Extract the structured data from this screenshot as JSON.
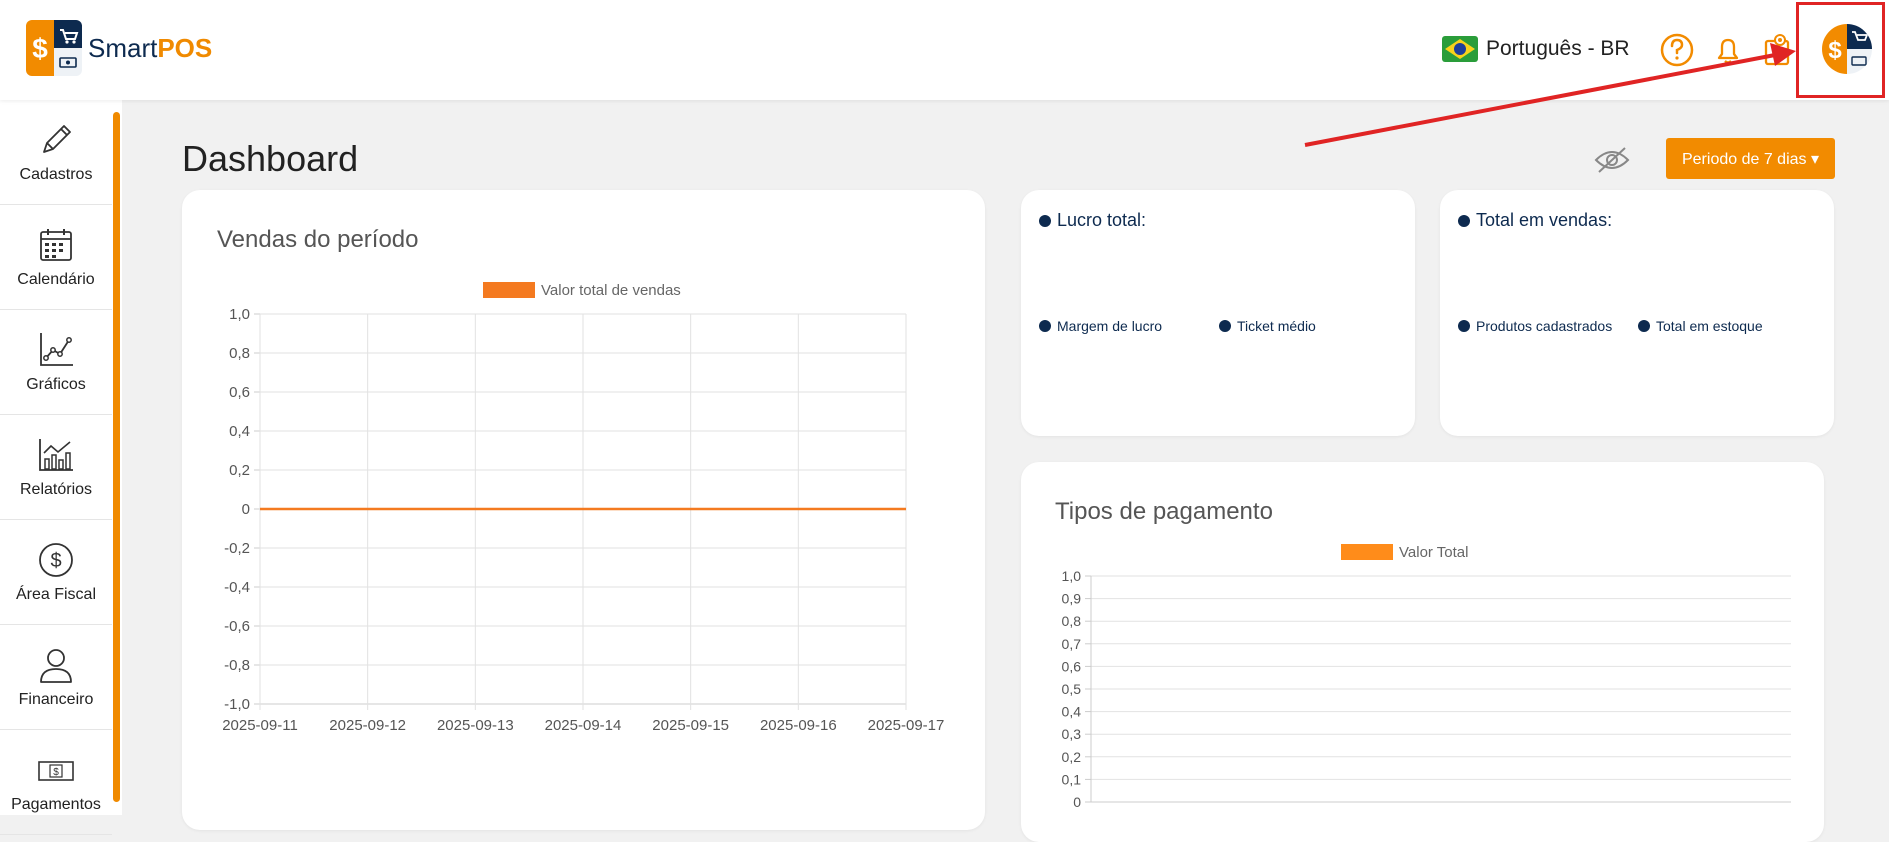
{
  "header": {
    "brand_part1": "Smart",
    "brand_part2": "POS",
    "language": "Português - BR",
    "icons": [
      "help-circle-icon",
      "bell-icon",
      "clipboard-camera-icon"
    ]
  },
  "sidebar": {
    "items": [
      {
        "label": "Cadastros",
        "icon": "pencil-icon"
      },
      {
        "label": "Calendário",
        "icon": "calendar-icon"
      },
      {
        "label": "Gráficos",
        "icon": "line-graph-icon"
      },
      {
        "label": "Relatórios",
        "icon": "bar-report-icon"
      },
      {
        "label": "Área Fiscal",
        "icon": "dollar-circle-icon"
      },
      {
        "label": "Financeiro",
        "icon": "person-icon"
      },
      {
        "label": "Pagamentos",
        "icon": "banknote-icon"
      }
    ]
  },
  "page": {
    "title": "Dashboard",
    "period_button": "Periodo de 7 dias"
  },
  "stats": {
    "profit": {
      "title": "Lucro total:",
      "sub1": "Margem de lucro",
      "sub2": "Ticket médio"
    },
    "sales": {
      "title": "Total em vendas:",
      "sub1": "Produtos cadastrados",
      "sub2": "Total em estoque"
    }
  },
  "colors": {
    "accent": "#f28b00",
    "navy": "#0d2a4f",
    "highlight": "#e02424"
  },
  "chart_data": [
    {
      "type": "line",
      "title": "Vendas do período",
      "categories": [
        "2025-09-11",
        "2025-09-12",
        "2025-09-13",
        "2025-09-14",
        "2025-09-15",
        "2025-09-16",
        "2025-09-17"
      ],
      "series": [
        {
          "name": "Valor total de vendas",
          "values": [
            0,
            0,
            0,
            0,
            0,
            0,
            0
          ],
          "color": "#f47a20"
        }
      ],
      "ylim": [
        -1,
        1
      ],
      "yticks": [
        "1,0",
        "0,8",
        "0,6",
        "0,4",
        "0,2",
        "0",
        "-0,2",
        "-0,4",
        "-0,6",
        "-0,8",
        "-1,0"
      ],
      "grid": true,
      "legend": "top"
    },
    {
      "type": "bar",
      "title": "Tipos de pagamento",
      "categories": [],
      "series": [
        {
          "name": "Valor Total",
          "values": [],
          "color": "#ff8c1a"
        }
      ],
      "ylim": [
        0,
        1
      ],
      "yticks": [
        "1,0",
        "0,9",
        "0,8",
        "0,7",
        "0,6",
        "0,5",
        "0,4",
        "0,3",
        "0,2",
        "0,1",
        "0"
      ],
      "grid": true,
      "legend": "top"
    }
  ]
}
